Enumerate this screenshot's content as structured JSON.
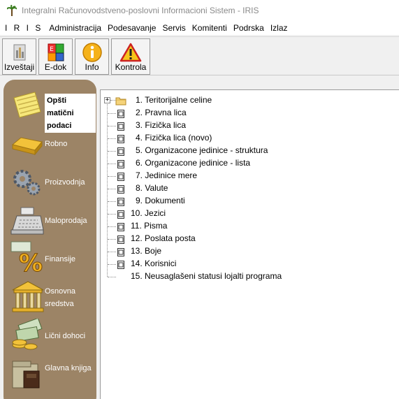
{
  "window": {
    "title": "Integralni Računovodstveno-poslovni Informacioni Sistem - IRIS",
    "app_icon": "palm-tree-icon"
  },
  "menu": {
    "items": [
      "I R I S",
      "Administracija",
      "Podesavanje",
      "Servis",
      "Komitenti",
      "Podrska",
      "Izlaz"
    ]
  },
  "toolbar": {
    "buttons": [
      {
        "label": "Izveštaji",
        "icon": "report-icon"
      },
      {
        "label": "E-dok",
        "icon": "edoc-icon"
      },
      {
        "label": "Info",
        "icon": "info-icon"
      },
      {
        "label": "Kontrola",
        "icon": "warning-icon"
      }
    ]
  },
  "sidebar": {
    "background": "#9c8466",
    "items": [
      {
        "label": "Opšti matični podaci",
        "icon": "notepad-icon",
        "active": true
      },
      {
        "label": "Robno",
        "icon": "gold-bar-icon"
      },
      {
        "label": "Proizvodnja",
        "icon": "gears-icon"
      },
      {
        "label": "Maloprodaja",
        "icon": "cash-register-icon"
      },
      {
        "label": "Finansije",
        "icon": "percent-icon"
      },
      {
        "label": "Osnovna sredstva",
        "icon": "bank-building-icon"
      },
      {
        "label": "Lični dohoci",
        "icon": "money-icon"
      },
      {
        "label": "Glavna knjiga",
        "icon": "ledger-icon"
      }
    ]
  },
  "tree": {
    "root_icon": "folder-icon",
    "nodes": [
      {
        "label": "1. Teritorijalne celine",
        "expandable": true
      },
      {
        "label": "2. Pravna lica"
      },
      {
        "label": "3. Fizička lica"
      },
      {
        "label": "4. Fizička lica (novo)"
      },
      {
        "label": "5. Organizacone jedinice - struktura"
      },
      {
        "label": "6. Organizacone jedinice - lista"
      },
      {
        "label": "7. Jedinice mere"
      },
      {
        "label": "8. Valute"
      },
      {
        "label": "9. Dokumenti"
      },
      {
        "label": "10. Jezici"
      },
      {
        "label": "11. Pisma"
      },
      {
        "label": "12. Poslata posta"
      },
      {
        "label": "13. Boje"
      },
      {
        "label": "14. Korisnici"
      },
      {
        "label": "15. Neusaglašeni statusi lojalti programa"
      }
    ]
  }
}
